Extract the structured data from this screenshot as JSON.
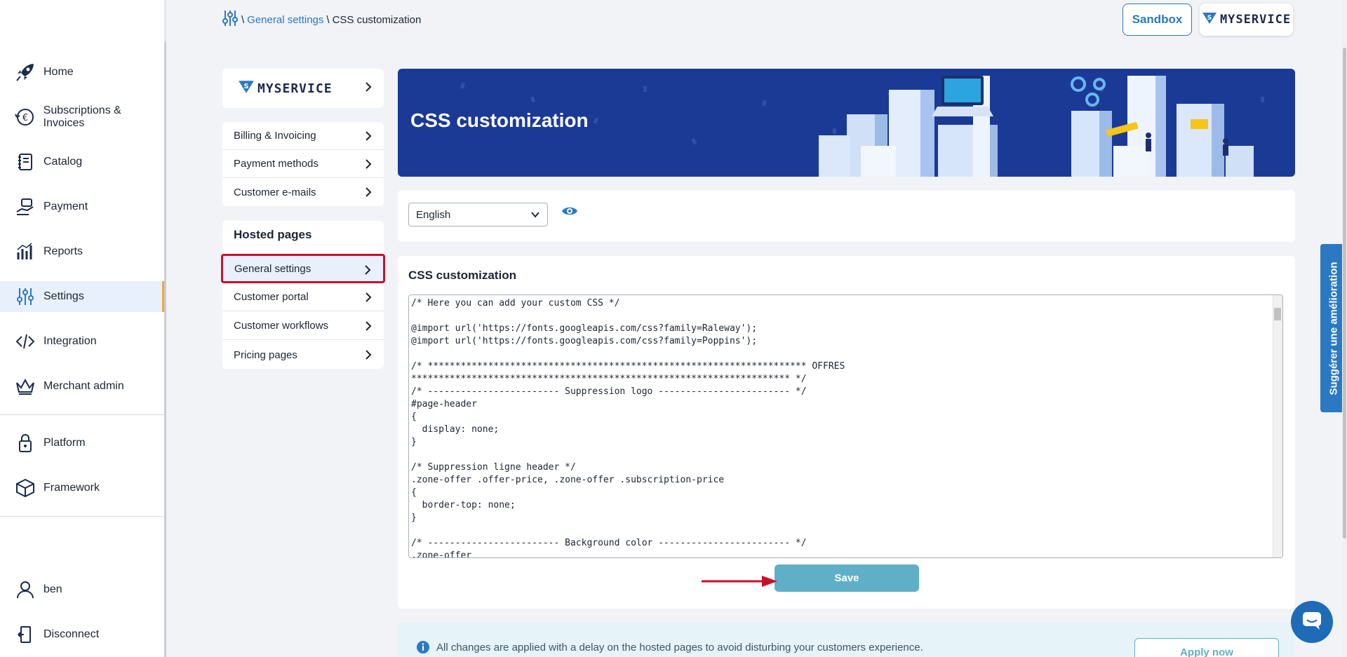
{
  "breadcrumb": {
    "link": "General settings",
    "current": "CSS customization"
  },
  "topbar": {
    "sandbox": "Sandbox",
    "brand": "MYSERVICE"
  },
  "nav": {
    "items": [
      {
        "label": "Home",
        "icon": "rocket-icon"
      },
      {
        "label": "Subscriptions & Invoices",
        "icon": "euro-cycle-icon"
      },
      {
        "label": "Catalog",
        "icon": "catalog-icon"
      },
      {
        "label": "Payment",
        "icon": "hand-money-icon"
      },
      {
        "label": "Reports",
        "icon": "chart-icon"
      },
      {
        "label": "Settings",
        "icon": "sliders-icon",
        "active": true
      },
      {
        "label": "Integration",
        "icon": "code-icon"
      },
      {
        "label": "Merchant admin",
        "icon": "crown-icon"
      },
      {
        "label": "Platform",
        "icon": "lock-icon"
      },
      {
        "label": "Framework",
        "icon": "box-icon"
      },
      {
        "label": "ben",
        "icon": "user-icon"
      },
      {
        "label": "Disconnect",
        "icon": "logout-icon"
      }
    ]
  },
  "submenu": {
    "brand": "MYSERVICE",
    "group1": [
      "Billing & Invoicing",
      "Payment methods",
      "Customer e-mails"
    ],
    "hosted_title": "Hosted pages",
    "group2": [
      "General settings",
      "Customer portal",
      "Customer workflows",
      "Pricing pages"
    ]
  },
  "banner": {
    "title": "CSS customization"
  },
  "lang": {
    "selected": "English"
  },
  "css_section": {
    "title": "CSS customization",
    "code": "/* Here you can add your custom CSS */\n\n@import url('https://fonts.googleapis.com/css?family=Raleway');\n@import url('https://fonts.googleapis.com/css?family=Poppins');\n\n/* ********************************************************************* OFFRES\n********************************************************************* */\n/* ------------------------ Suppression logo ------------------------ */\n#page-header\n{\n  display: none;\n}\n\n/* Suppression ligne header */\n.zone-offer .offer-price, .zone-offer .subscription-price\n{\n  border-top: none;\n}\n\n/* ------------------------ Background color ------------------------ */\n.zone-offer",
    "save": "Save"
  },
  "notice": {
    "text": "All changes are applied with a delay on the hosted pages to avoid disturbing your customers experience.",
    "apply": "Apply now"
  },
  "suggest": "Suggérer une amélioration",
  "colors": {
    "accent": "#2b79c2",
    "banner": "#1b3a96",
    "save": "#5fb0c7",
    "highlight": "#c8102e",
    "active_border": "#f2a541"
  }
}
